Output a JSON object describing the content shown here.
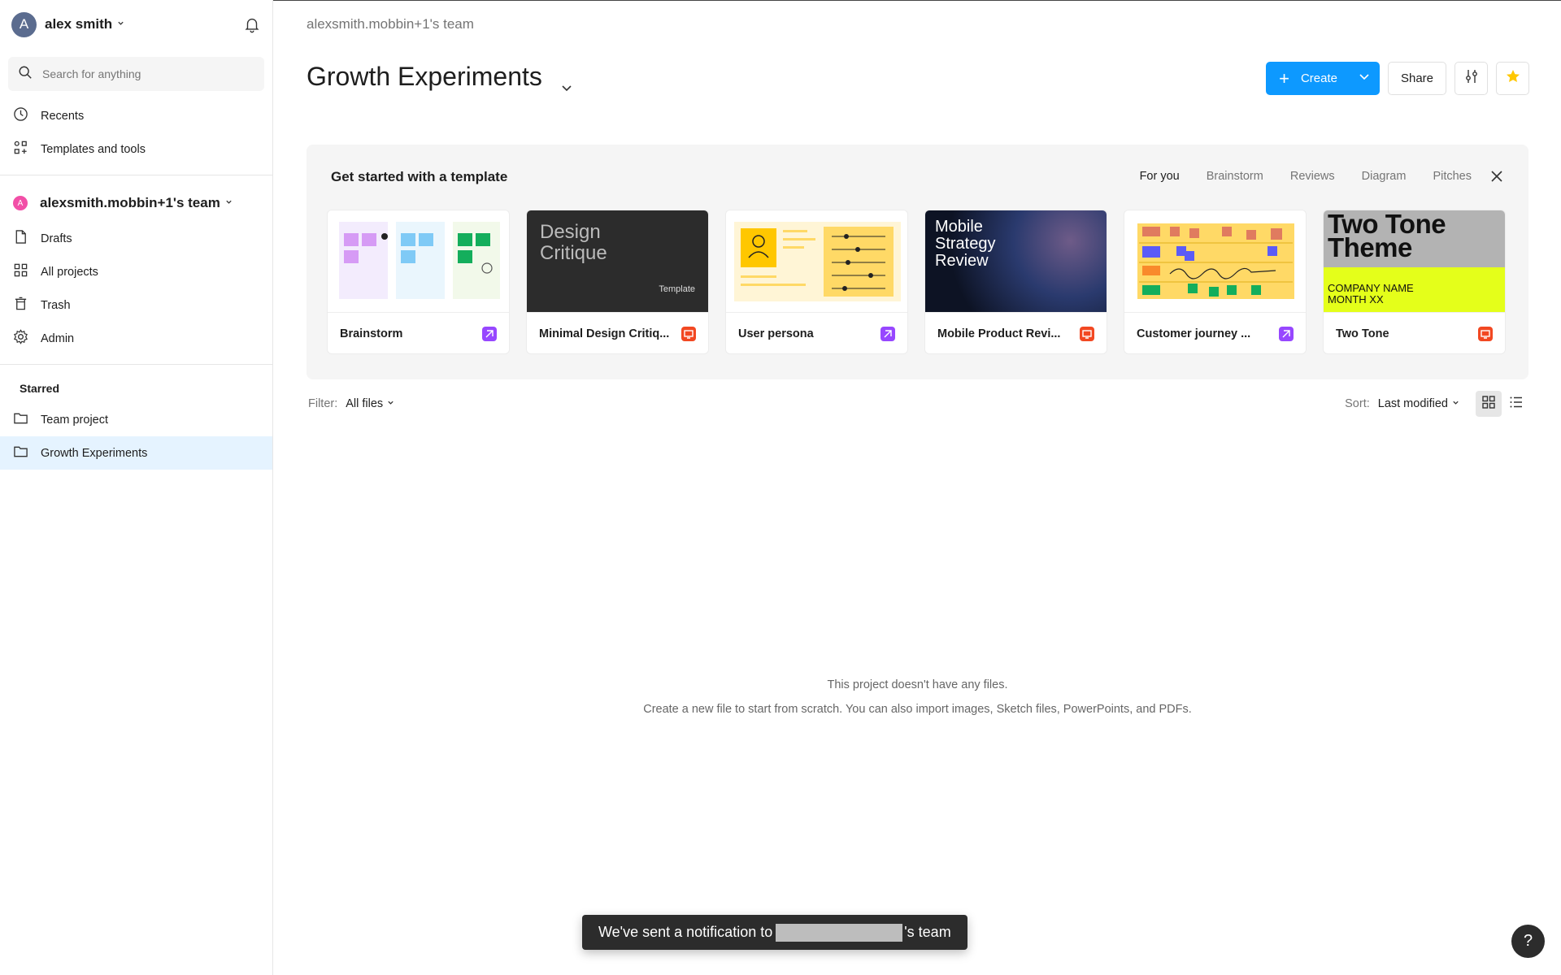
{
  "user": {
    "name": "alex smith",
    "initial": "A"
  },
  "search": {
    "placeholder": "Search for anything"
  },
  "nav_top": [
    {
      "label": "Recents",
      "icon": "clock-icon"
    },
    {
      "label": "Templates and tools",
      "icon": "templates-icon"
    }
  ],
  "team": {
    "name": "alexsmith.mobbin+1's team",
    "initial": "A"
  },
  "nav_team": [
    {
      "label": "Drafts",
      "icon": "file-icon"
    },
    {
      "label": "All projects",
      "icon": "grid-icon"
    },
    {
      "label": "Trash",
      "icon": "trash-icon"
    },
    {
      "label": "Admin",
      "icon": "gear-icon"
    }
  ],
  "starred": {
    "title": "Starred",
    "items": [
      {
        "label": "Team project",
        "icon": "folder-icon"
      },
      {
        "label": "Growth Experiments",
        "icon": "folder-icon",
        "active": true
      }
    ]
  },
  "main": {
    "breadcrumb": "alexsmith.mobbin+1's team",
    "title": "Growth Experiments",
    "create_label": "Create",
    "share_label": "Share"
  },
  "templates": {
    "header": "Get started with a template",
    "tabs": [
      "For you",
      "Brainstorm",
      "Reviews",
      "Diagram",
      "Pitches"
    ],
    "active_tab": "For you",
    "cards": [
      {
        "name": "Brainstorm",
        "badge": "figjam",
        "badge_color": "#9747ff"
      },
      {
        "name": "Minimal Design Critiq...",
        "badge": "slides",
        "badge_color": "#f24822",
        "thumb_title": "Design Critique",
        "thumb_sub": "Template"
      },
      {
        "name": "User persona",
        "badge": "figjam",
        "badge_color": "#9747ff"
      },
      {
        "name": "Mobile Product Revi...",
        "badge": "slides",
        "badge_color": "#f24822",
        "thumb_title": "Mobile Strategy Review"
      },
      {
        "name": "Customer journey ...",
        "badge": "figjam",
        "badge_color": "#9747ff"
      },
      {
        "name": "Two Tone",
        "badge": "slides",
        "badge_color": "#f24822",
        "thumb_title": "Two Tone Theme",
        "thumb_sub": "COMPANY NAME MONTH XX"
      }
    ]
  },
  "filter": {
    "label": "Filter:",
    "value": "All files"
  },
  "sort": {
    "label": "Sort:",
    "value": "Last modified"
  },
  "empty": {
    "line1": "This project doesn't have any files.",
    "line2": "Create a new file to start from scratch. You can also import images, Sketch files, PowerPoints, and PDFs."
  },
  "toast": {
    "prefix": "We've sent a notification to",
    "suffix": "'s team"
  },
  "help_label": "?",
  "colors": {
    "accent": "#0d99ff",
    "active_bg": "#e5f3ff",
    "star": "#ffc700"
  }
}
